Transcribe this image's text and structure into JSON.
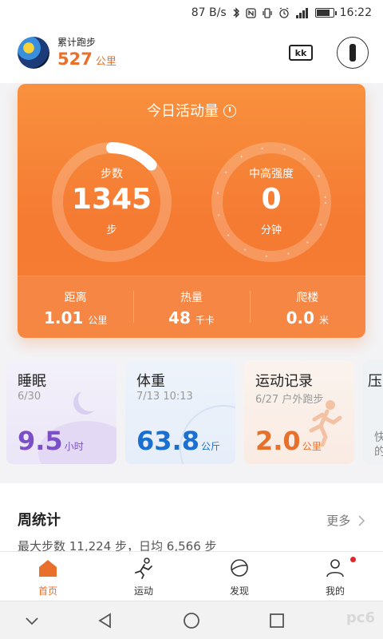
{
  "status_bar": {
    "speed": "87 B/s",
    "time": "16:22"
  },
  "header": {
    "total_label": "累计跑步",
    "total_value": "527",
    "total_unit": "公里",
    "kk_label": "kk"
  },
  "activity": {
    "title": "今日活动量",
    "steps": {
      "label": "步数",
      "value": "1345",
      "unit": "步",
      "progress": 0.13
    },
    "intensity": {
      "label": "中高强度",
      "value": "0",
      "unit": "分钟"
    },
    "metrics": [
      {
        "label": "距离",
        "value": "1.01",
        "unit": "公里"
      },
      {
        "label": "热量",
        "value": "48",
        "unit": "千卡"
      },
      {
        "label": "爬楼",
        "value": "0.0",
        "unit": "米"
      }
    ]
  },
  "tiles": {
    "sleep": {
      "title": "睡眠",
      "date": "6/30",
      "value": "9.5",
      "unit": "小时"
    },
    "weight": {
      "title": "体重",
      "date": "7/13 10:13",
      "value": "63.8",
      "unit": "公斤"
    },
    "record": {
      "title": "运动记录",
      "date": "6/27 户外跑步",
      "value": "2.0",
      "unit": "公里"
    },
    "extra": {
      "title": "压",
      "sub": "快",
      "sub2": "的"
    }
  },
  "weekly": {
    "title": "周统计",
    "more": "更多",
    "stats": "最大步数 11,224 步，日均 6,566 步"
  },
  "nav": [
    {
      "label": "首页"
    },
    {
      "label": "运动"
    },
    {
      "label": "发现"
    },
    {
      "label": "我的"
    }
  ],
  "watermark": "pc6",
  "colors": {
    "accent": "#e8702a",
    "sleep": "#7a4fc7",
    "weight": "#1a6fd1",
    "badge": "#e5252c"
  }
}
